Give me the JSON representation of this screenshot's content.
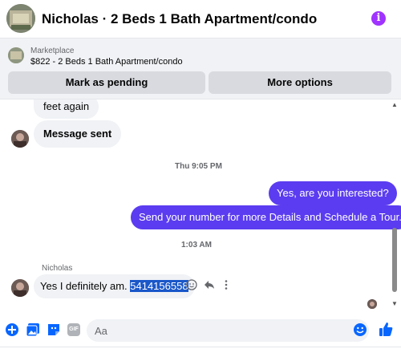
{
  "header": {
    "title": "Nicholas · 2 Beds 1 Bath Apartment/condo",
    "info_glyph": "i",
    "accent": "#a033ff"
  },
  "marketplace": {
    "label": "Marketplace",
    "listing": "$822 - 2 Beds 1 Bath Apartment/condo",
    "buttons": {
      "pending": "Mark as pending",
      "more": "More options"
    }
  },
  "conversation": {
    "partial_incoming": "feet again",
    "message_sent": "Message sent",
    "timestamp_1": "Thu 9:05 PM",
    "outgoing_1": "Yes, are you interested?",
    "outgoing_2": "Send your number for more Details and Schedule a Tour.",
    "timestamp_2": "1:03 AM",
    "sender": "Nicholas",
    "reply_text": "Yes I definitely am. ",
    "reply_highlight": "5414156558",
    "outgoing_color": "#5b3cf0"
  },
  "composer": {
    "placeholder": "Aa",
    "gif_label": "GIF",
    "icon_color": "#0866ff"
  },
  "icons": [
    "plus-icon",
    "photo-icon",
    "sticker-icon",
    "gif-icon",
    "emoji-icon",
    "thumbs-up-icon",
    "smiley-react-icon",
    "reply-icon",
    "more-dots-icon",
    "info-icon"
  ]
}
